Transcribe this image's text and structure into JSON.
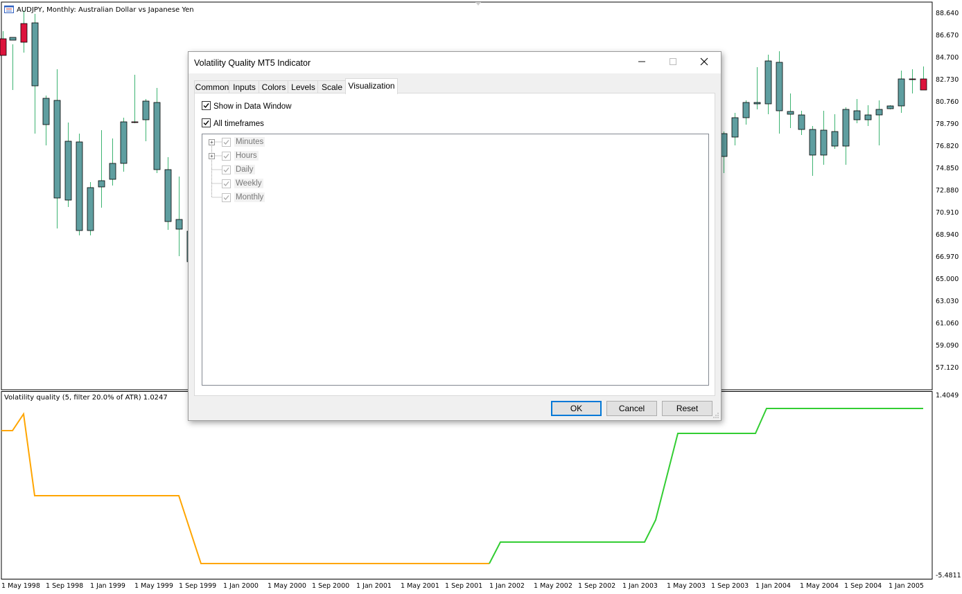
{
  "main_chart": {
    "title": "AUDJPY, Monthly:  Australian Dollar vs Japanese Yen",
    "price_axis": [
      "88.640",
      "86.670",
      "84.700",
      "82.730",
      "80.760",
      "78.790",
      "76.820",
      "74.850",
      "72.880",
      "70.910",
      "68.940",
      "66.970",
      "65.000",
      "63.030",
      "61.060",
      "59.090",
      "57.120"
    ],
    "colors": {
      "bull": "#5f9ea0",
      "bear": "#dc143c",
      "wick": "#3cb371"
    }
  },
  "indicator": {
    "title": "Volatility quality (5, filter 20.0% of ATR) 1.0247",
    "axis_top": "1.4049",
    "axis_bottom": "-5.4811",
    "colors": {
      "down": "#ffa500",
      "up": "#32cd32"
    }
  },
  "time_axis": [
    "1 May 1998",
    "1 Sep 1998",
    "1 Jan 1999",
    "1 May 1999",
    "1 Sep 1999",
    "1 Jan 2000",
    "1 May 2000",
    "1 Sep 2000",
    "1 Jan 2001",
    "1 May 2001",
    "1 Sep 2001",
    "1 Jan 2002",
    "1 May 2002",
    "1 Sep 2002",
    "1 Jan 2003",
    "1 May 2003",
    "1 Sep 2003",
    "1 Jan 2004",
    "1 May 2004",
    "1 Sep 2004",
    "1 Jan 2005"
  ],
  "dialog": {
    "title": "Volatility Quality MT5 Indicator",
    "tabs": [
      "Common",
      "Inputs",
      "Colors",
      "Levels",
      "Scale",
      "Visualization"
    ],
    "active_tab": "Visualization",
    "show_in_data_window": "Show in Data Window",
    "all_timeframes": "All timeframes",
    "timeframes": [
      "Minutes",
      "Hours",
      "Daily",
      "Weekly",
      "Monthly"
    ],
    "buttons": {
      "ok": "OK",
      "cancel": "Cancel",
      "reset": "Reset"
    },
    "win_buttons": {
      "minimize": "minimize-icon",
      "maximize": "maximize-icon",
      "close": "close-icon"
    }
  }
}
